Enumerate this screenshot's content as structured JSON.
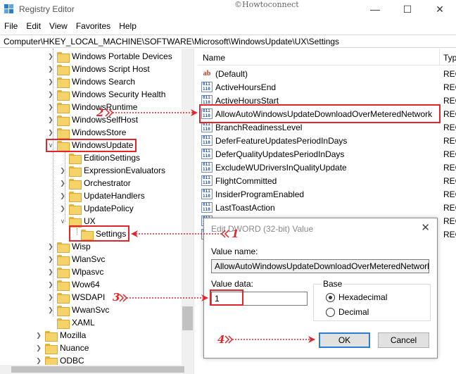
{
  "window": {
    "title": "Registry Editor",
    "watermark": "©Howtoconnect",
    "minimize_glyph": "—",
    "maximize_glyph": "☐",
    "close_glyph": "✕"
  },
  "menu": [
    "File",
    "Edit",
    "View",
    "Favorites",
    "Help"
  ],
  "address": "Computer\\HKEY_LOCAL_MACHINE\\SOFTWARE\\Microsoft\\WindowsUpdate\\UX\\Settings",
  "tree": {
    "items": [
      {
        "label": "Windows Portable Devices"
      },
      {
        "label": "Windows Script Host"
      },
      {
        "label": "Windows Search"
      },
      {
        "label": "Windows Security Health"
      },
      {
        "label": "WindowsRuntime"
      },
      {
        "label": "WindowsSelfHost"
      },
      {
        "label": "WindowsStore"
      },
      {
        "label": "WindowsUpdate",
        "expanded": true
      },
      {
        "label": "EditionSettings"
      },
      {
        "label": "ExpressionEvaluators"
      },
      {
        "label": "Orchestrator"
      },
      {
        "label": "UpdateHandlers"
      },
      {
        "label": "UpdatePolicy"
      },
      {
        "label": "UX",
        "expanded": true
      },
      {
        "label": "Settings",
        "selected": true
      },
      {
        "label": "Wisp"
      },
      {
        "label": "WlanSvc"
      },
      {
        "label": "Wlpasvc"
      },
      {
        "label": "Wow64"
      },
      {
        "label": "WSDAPI"
      },
      {
        "label": "WwanSvc"
      },
      {
        "label": "XAML"
      },
      {
        "label": "Mozilla"
      },
      {
        "label": "Nuance"
      },
      {
        "label": "ODBC"
      }
    ]
  },
  "values_pane": {
    "col_name": "Name",
    "col_type": "Typ",
    "rows": [
      {
        "icon": "string-value-icon",
        "glyph": "ab",
        "name": "(Default)",
        "type": "REG"
      },
      {
        "icon": "binary-value-icon",
        "name": "ActiveHoursEnd",
        "type": "REG"
      },
      {
        "icon": "binary-value-icon",
        "name": "ActiveHoursStart",
        "type": "REG"
      },
      {
        "icon": "binary-value-icon",
        "name": "AllowAutoWindowsUpdateDownloadOverMeteredNetwork",
        "type": "REG",
        "highlight": true
      },
      {
        "icon": "binary-value-icon",
        "name": "BranchReadinessLevel",
        "type": "REG"
      },
      {
        "icon": "binary-value-icon",
        "name": "DeferFeatureUpdatesPeriodInDays",
        "type": "REG"
      },
      {
        "icon": "binary-value-icon",
        "name": "DeferQualityUpdatesPeriodInDays",
        "type": "REG"
      },
      {
        "icon": "binary-value-icon",
        "name": "ExcludeWUDriversInQualityUpdate",
        "type": "REG"
      },
      {
        "icon": "binary-value-icon",
        "name": "FlightCommitted",
        "type": "REG"
      },
      {
        "icon": "binary-value-icon",
        "name": "InsiderProgramEnabled",
        "type": "REG"
      },
      {
        "icon": "binary-value-icon",
        "name": "LastToastAction",
        "type": "REG"
      },
      {
        "icon": "binary-value-icon",
        "name": "",
        "type": "REG"
      },
      {
        "icon": "binary-value-icon",
        "name": "",
        "type": "REG"
      }
    ]
  },
  "dialog": {
    "title": "Edit DWORD (32-bit) Value",
    "close_glyph": "✕",
    "value_name_label": "Value name:",
    "value_name": "AllowAutoWindowsUpdateDownloadOverMeteredNetwork",
    "value_data_label": "Value data:",
    "value_data": "1",
    "base_label": "Base",
    "radio_hex": "Hexadecimal",
    "radio_dec": "Decimal",
    "selected_base": "Hexadecimal",
    "ok_label": "OK",
    "cancel_label": "Cancel"
  },
  "annotations": {
    "step1": "1",
    "step2": "2",
    "step3": "3",
    "step4": "4",
    "color": "#e3242b"
  }
}
